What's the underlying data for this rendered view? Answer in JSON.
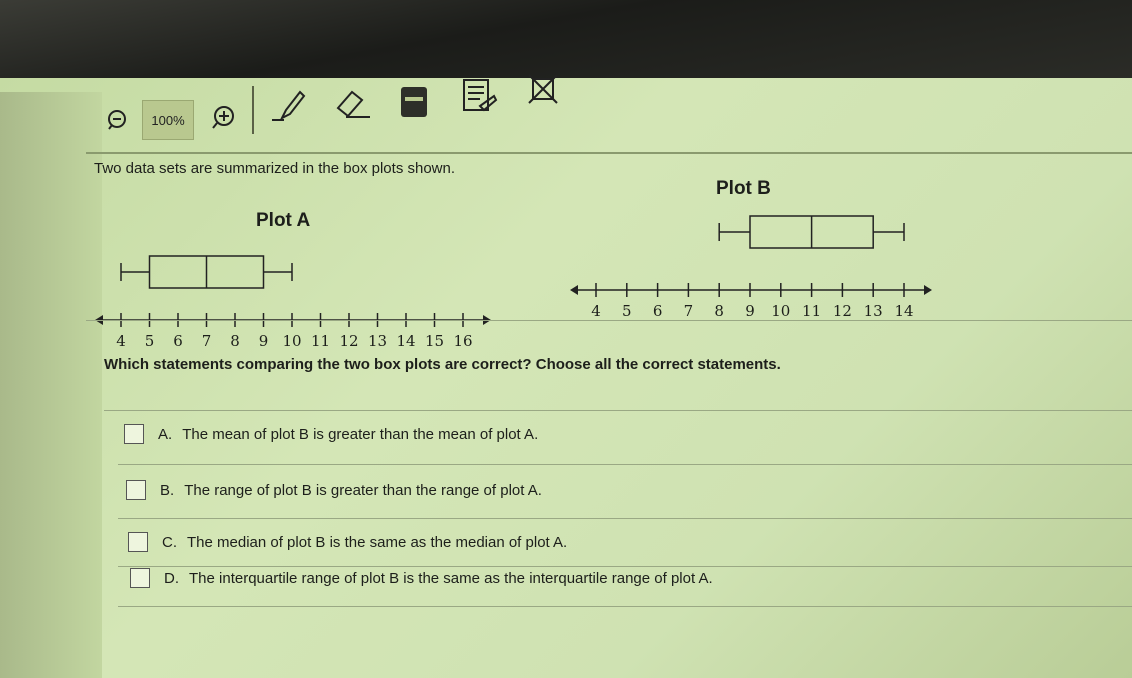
{
  "toolbar": {
    "zoom_level": "100%",
    "icons": [
      "zoom-out-icon",
      "zoom-in-icon",
      "pencil-icon",
      "eraser-icon",
      "calculator-icon",
      "notepad-icon",
      "cross-out-icon"
    ]
  },
  "question": {
    "text": "Two data sets are summarized in the box plots shown.",
    "prompt": "Which statements comparing the two box plots are correct? Choose all the correct statements."
  },
  "plots": [
    {
      "title": "Plot A",
      "axis_ticks": [
        "4",
        "5",
        "6",
        "7",
        "8",
        "9",
        "10",
        "11",
        "12",
        "13",
        "14",
        "15",
        "16"
      ],
      "min": 4,
      "q1": 5,
      "median": 7,
      "q3": 9,
      "max": 10
    },
    {
      "title": "Plot B",
      "axis_ticks": [
        "4",
        "5",
        "6",
        "7",
        "8",
        "9",
        "10",
        "11",
        "12",
        "13",
        "14"
      ],
      "min": 8,
      "q1": 9,
      "median": 11,
      "q3": 13,
      "max": 14
    }
  ],
  "options": [
    {
      "letter": "A.",
      "text": "The mean of plot B is greater than the mean of plot A."
    },
    {
      "letter": "B.",
      "text": "The range of plot B is greater than the range of plot A."
    },
    {
      "letter": "C.",
      "text": "The median of plot B is the same as the median of plot A."
    },
    {
      "letter": "D.",
      "text": "The interquartile range of plot B is the same as the interquartile range of plot A."
    }
  ]
}
